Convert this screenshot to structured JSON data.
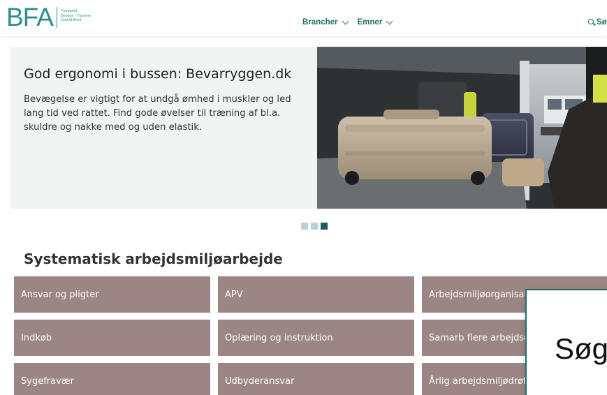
{
  "header": {
    "logo_text": "BFA",
    "logo_tagline": [
      "Transport",
      "Service - Turisme",
      "Jord til Bord"
    ],
    "nav": [
      {
        "label": "Brancher"
      },
      {
        "label": "Emner"
      }
    ],
    "search_label": "Søg"
  },
  "hero": {
    "title": "God ergonomi i bussen: Bevarryggen.dk",
    "text": "Bevægelse er vigtigt for at undgå ømhed i muskler og led lang tid ved rattet. Find gode øvelser til træning af bl.a. skuldre og nakke med  og uden elastik.",
    "slide_count": 3,
    "active_slide": 3
  },
  "section": {
    "title": "Systematisk arbejdsmiljøarbejde",
    "tiles": [
      {
        "label": "Ansvar og pligter"
      },
      {
        "label": "APV"
      },
      {
        "label": "Arbejdsmiljøorganisation"
      },
      {
        "label": "Indkøb"
      },
      {
        "label": "Oplæring og instruktion"
      },
      {
        "label": "Samarb flere arbejdsgivere"
      },
      {
        "label": "Sygefravær"
      },
      {
        "label": "Udbyderansvar"
      },
      {
        "label": "Årlig arbejdsmiljødrøftelse"
      }
    ]
  },
  "popup": {
    "text": "Søg"
  },
  "colors": {
    "brand": "#2a8f8a",
    "nav_text": "#1e6f6a",
    "tile_bg": "#9c8585",
    "hero_bg": "#f2f4f4",
    "dot_inactive": "#b9d1d3",
    "dot_active": "#1d5a62"
  }
}
